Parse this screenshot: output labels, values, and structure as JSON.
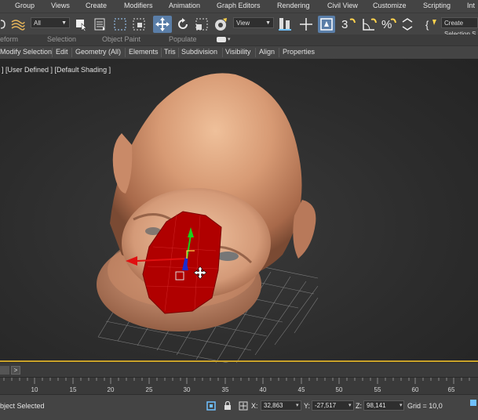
{
  "menubar": {
    "items": [
      "Group",
      "Views",
      "Create",
      "Modifiers",
      "Animation",
      "Graph Editors",
      "Rendering",
      "Civil View",
      "Customize",
      "Scripting",
      "Int"
    ]
  },
  "toolbar": {
    "filter_dropdown": "All",
    "view_dropdown": "View",
    "create_selection_label": "Create Selection S"
  },
  "ribbon": {
    "tabs": [
      "eform",
      "Selection",
      "Object Paint",
      "Populate"
    ]
  },
  "subobject_bar": {
    "items": [
      "Modify Selection",
      "Edit",
      "Geometry (All)",
      "Elements",
      "Tris",
      "Subdivision",
      "Visibility",
      "Align",
      "Properties"
    ]
  },
  "viewport": {
    "label": "] [User Defined ] [Default Shading ]"
  },
  "timeslider": {
    "arrow": ">"
  },
  "trackbar": {
    "ticks": [
      "10",
      "15",
      "20",
      "25",
      "30",
      "35",
      "40",
      "45",
      "50",
      "55",
      "60",
      "65"
    ]
  },
  "status": {
    "selection_text": "bject Selected",
    "x_label": "X:",
    "x_value": "32,863",
    "y_label": "Y:",
    "y_value": "-27,517",
    "z_label": "Z:",
    "z_value": "98,141",
    "grid": "Grid = 10,0"
  },
  "colors": {
    "accent_yellow": "#c9a22a",
    "selection_red": "#b00000",
    "skin": "#d8a080"
  }
}
